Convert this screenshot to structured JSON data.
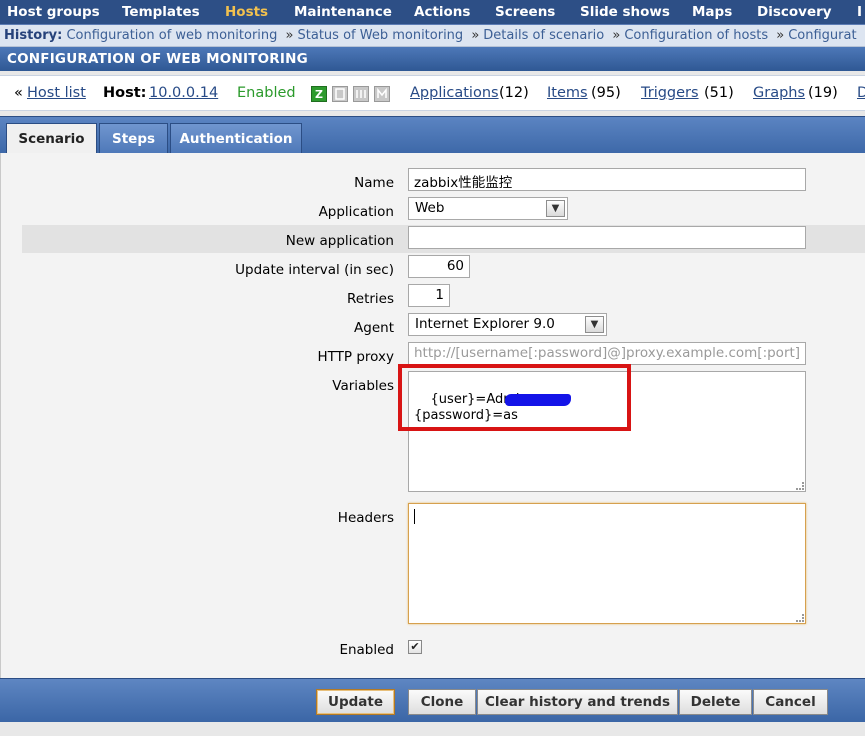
{
  "topnav": {
    "items": [
      "Host groups",
      "Templates",
      "Hosts",
      "Maintenance",
      "Actions",
      "Screens",
      "Slide shows",
      "Maps",
      "Discovery",
      "I"
    ]
  },
  "history": {
    "label": "History:",
    "links": [
      "Configuration of web monitoring",
      "Status of Web monitoring",
      "Details of scenario",
      "Configuration of hosts",
      "Configurat"
    ]
  },
  "page_title": "CONFIGURATION OF WEB MONITORING",
  "hostbar": {
    "prefix": "«",
    "host_list": "Host list",
    "host_label": "Host:",
    "host_value": "10.0.0.14",
    "status": "Enabled",
    "icons": [
      "Z",
      "SNMP",
      "JMX",
      "IPMI"
    ],
    "applications": "Applications",
    "applications_count": "(12)",
    "items": "Items",
    "items_count": "(95)",
    "triggers": "Triggers",
    "triggers_count": "(51)",
    "graphs": "Graphs",
    "graphs_count": "(19)",
    "next": "D"
  },
  "tabs": [
    "Scenario",
    "Steps",
    "Authentication"
  ],
  "form": {
    "name_label": "Name",
    "name_value": "zabbix性能监控",
    "application_label": "Application",
    "application_value": "Web",
    "new_application_label": "New application",
    "new_application_value": "",
    "update_interval_label": "Update interval (in sec)",
    "update_interval_value": "60",
    "retries_label": "Retries",
    "retries_value": "1",
    "agent_label": "Agent",
    "agent_value": "Internet Explorer 9.0",
    "http_proxy_label": "HTTP proxy",
    "http_proxy_placeholder": "http://[username[:password]@]proxy.example.com[:port]",
    "variables_label": "Variables",
    "variables_value": "{user}=Admin\n{password}=as",
    "headers_label": "Headers",
    "headers_value": "",
    "enabled_label": "Enabled",
    "enabled_checked": true
  },
  "buttons": {
    "update": "Update",
    "clone": "Clone",
    "clear": "Clear history and trends",
    "delete": "Delete",
    "cancel": "Cancel"
  }
}
